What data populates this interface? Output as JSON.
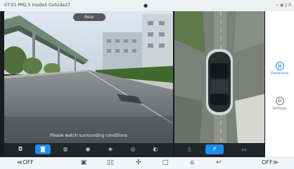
{
  "status_bar": {
    "left_text": "07:01  PM2.5 Inside5 Outside27",
    "center_icon": "circle-dot-icon",
    "right_icons": "⌁ ◉ ▯ 0"
  },
  "rear_view": {
    "label": "Rear",
    "notice": "Please watch surrounding conditions"
  },
  "mode_buttons": [
    {
      "icon": "car-front-view-icon",
      "glyph": "◘",
      "active": false
    },
    {
      "icon": "car-rear-view-icon",
      "glyph": "◙",
      "active": true
    },
    {
      "icon": "car-left-view-icon",
      "glyph": "◍",
      "active": false
    },
    {
      "icon": "car-right-view-icon",
      "glyph": "◉",
      "active": false
    },
    {
      "icon": "car-top-view-icon",
      "glyph": "◈",
      "active": false
    },
    {
      "icon": "car-left-rear-view-icon",
      "glyph": "◎",
      "active": false
    },
    {
      "icon": "car-3d-view-icon",
      "glyph": "◐",
      "active": false
    }
  ],
  "bird_buttons": [
    {
      "icon": "door-icon",
      "glyph": "▯",
      "active": false
    },
    {
      "icon": "parking-icon",
      "glyph": "P",
      "active": true
    },
    {
      "icon": "camera-icon",
      "glyph": "▭",
      "active": false
    }
  ],
  "side_panel": {
    "items": [
      {
        "label": "Panorama",
        "glyph": "◍",
        "active": true
      },
      {
        "label": "Settings",
        "glyph": "⚙",
        "active": false
      }
    ]
  },
  "nav": {
    "left_toggle": "≪OFF",
    "right_toggle": "OFF≫",
    "icons": [
      {
        "name": "radio-icon",
        "glyph": "▣"
      },
      {
        "name": "media-icon",
        "glyph": "▯▯"
      },
      {
        "name": "fan-icon",
        "glyph": "✣"
      },
      {
        "name": "square-icon",
        "glyph": "□"
      },
      {
        "name": "home-icon",
        "glyph": "⌂"
      },
      {
        "name": "back-icon",
        "glyph": "↩"
      }
    ]
  },
  "colors": {
    "accent": "#1f8cf0",
    "side_active": "#1f8cf0",
    "side_inactive": "#777777"
  }
}
